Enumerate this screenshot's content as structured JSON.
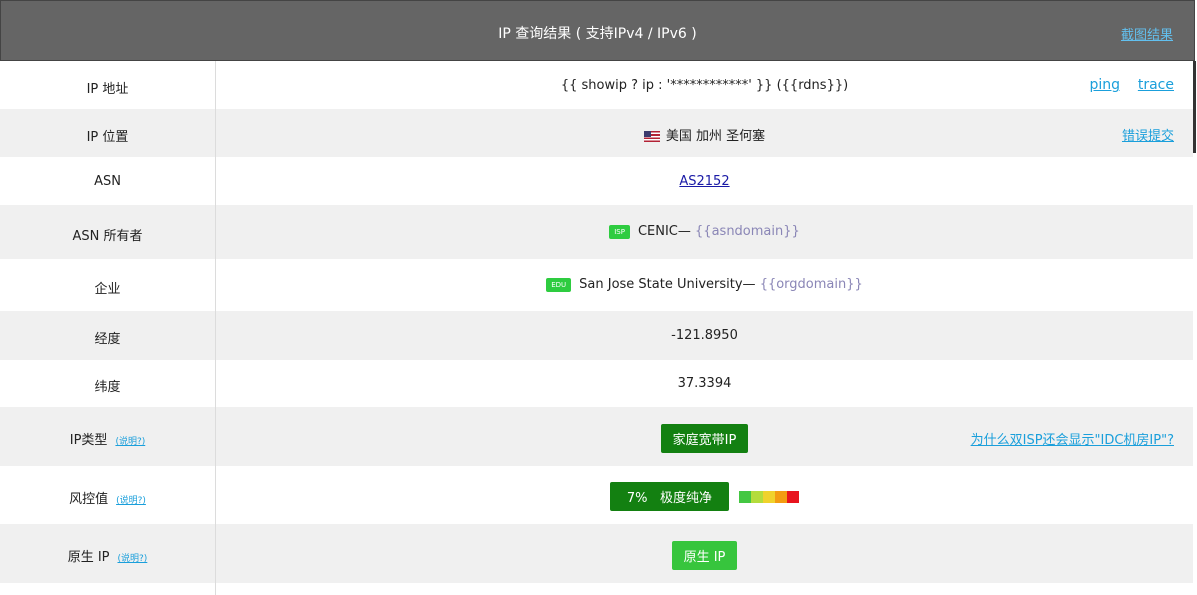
{
  "header": {
    "title": "IP 查询结果 ( 支持IPv4 / IPv6 )",
    "screenshot_link": "截图结果"
  },
  "rows": {
    "ip": {
      "label": "IP 地址",
      "value": "{{ showip ? ip : '************' }} ({{rdns}})",
      "ping": "ping",
      "trace": "trace"
    },
    "location": {
      "label": "IP 位置",
      "value": "美国 加州 圣何塞",
      "flag": "us-flag-icon",
      "report": "错误提交"
    },
    "asn": {
      "label": "ASN",
      "value": "AS2152"
    },
    "asn_owner": {
      "label": "ASN 所有者",
      "tag": "ISP",
      "value": "CENIC—",
      "domain": "{{asndomain}}"
    },
    "company": {
      "label": "企业",
      "tag": "EDU",
      "value": "San Jose State University—",
      "domain": "{{orgdomain}}"
    },
    "longitude": {
      "label": "经度",
      "value": "-121.8950"
    },
    "latitude": {
      "label": "纬度",
      "value": "37.3394"
    },
    "ip_type": {
      "label": "IP类型",
      "hint": "(说明?)",
      "value": "家庭宽带IP",
      "why": "为什么双ISP还会显示\"IDC机房IP\"?"
    },
    "risk": {
      "label": "风控值",
      "hint": "(说明?)",
      "percent": "7%",
      "text": "极度纯净",
      "scale_colors": [
        "#44c742",
        "#b4dc3c",
        "#f0d22c",
        "#f39c12",
        "#e8141e"
      ]
    },
    "native": {
      "label": "原生 IP",
      "hint": "(说明?)",
      "value": "原生 IP"
    }
  },
  "colors": {
    "header_bg": "#656565",
    "link": "#1a9fdb",
    "green_dark": "#138011",
    "green_light": "#37c53d"
  }
}
